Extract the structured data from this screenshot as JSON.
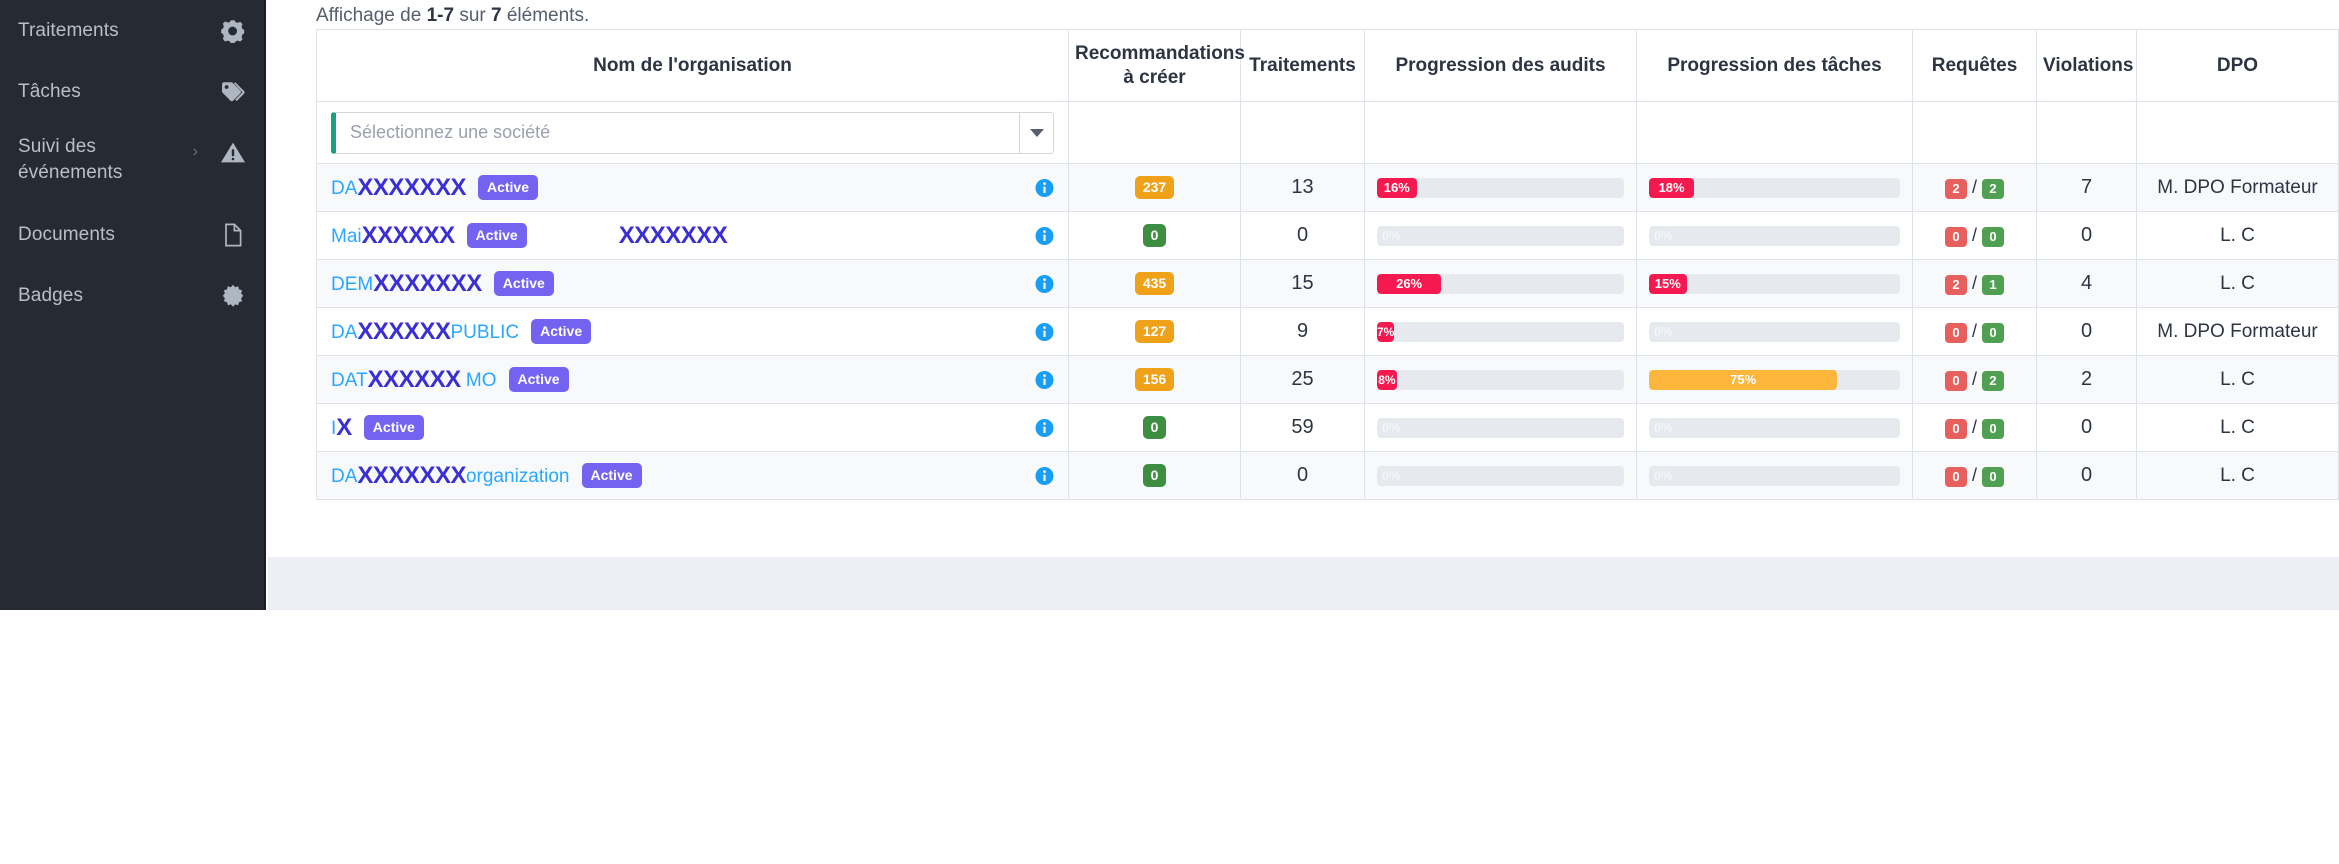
{
  "sidebar": {
    "items": [
      {
        "label": "Traitements",
        "icon": "cogs-icon",
        "has_chevron": false
      },
      {
        "label": "Tâches",
        "icon": "tags-icon",
        "has_chevron": false
      },
      {
        "label": "Suivi des événements",
        "icon": "warning-triangle-icon",
        "has_chevron": true,
        "chevron": "›"
      },
      {
        "label": "Documents",
        "icon": "file-icon",
        "has_chevron": false
      },
      {
        "label": "Badges",
        "icon": "badge-icon",
        "has_chevron": false
      }
    ],
    "background_color": "#262b33",
    "text_color": "#b9bfc8"
  },
  "summary": {
    "prefix": "Affichage de ",
    "range": "1-7",
    "middle": " sur ",
    "total": "7",
    "suffix": " éléments."
  },
  "filter": {
    "select_placeholder": "Sélectionnez une société",
    "accent_color": "#1aa083",
    "arrow_icon": "chevron-down-icon"
  },
  "table": {
    "columns": [
      "Nom de l'organisation",
      "Recommandations\nà créer",
      "Traitements",
      "Progression des audits",
      "Progression des tâches",
      "Requêtes",
      "Violations",
      "DPO"
    ],
    "columns_split": {
      "reco_line1": "Recommandations",
      "reco_line2": "à créer"
    },
    "badge_label": "Active",
    "info_icon": "info-circle-icon",
    "rows": [
      {
        "name_prefix": "DA",
        "name_redacted": "XXXXXXX",
        "name_suffix": "",
        "name_extra": "",
        "status": "Active",
        "recommandations": "237",
        "recommandations_color": "orange",
        "traitements": "13",
        "audit_pct": 16,
        "audit_label": "16%",
        "audit_color": "red",
        "task_pct": 18,
        "task_label": "18%",
        "task_color": "red",
        "requetes_red": "2",
        "requetes_green": "2",
        "violations": "7",
        "dpo": "M. DPO Formateur"
      },
      {
        "name_prefix": "Mai",
        "name_redacted": "XXXXXX",
        "name_suffix": "",
        "name_extra": "XXXXXXX",
        "status": "Active",
        "recommandations": "0",
        "recommandations_color": "green",
        "traitements": "0",
        "audit_pct": 0,
        "audit_label": "0%",
        "audit_color": "zero",
        "task_pct": 0,
        "task_label": "0%",
        "task_color": "zero",
        "requetes_red": "0",
        "requetes_green": "0",
        "violations": "0",
        "dpo": "L. C"
      },
      {
        "name_prefix": "DEM",
        "name_redacted": "XXXXXXX",
        "name_suffix": "",
        "name_extra": "",
        "status": "Active",
        "recommandations": "435",
        "recommandations_color": "orange",
        "traitements": "15",
        "audit_pct": 26,
        "audit_label": "26%",
        "audit_color": "red",
        "task_pct": 15,
        "task_label": "15%",
        "task_color": "red",
        "requetes_red": "2",
        "requetes_green": "1",
        "violations": "4",
        "dpo": "L. C"
      },
      {
        "name_prefix": "DA",
        "name_redacted": "XXXXXX",
        "name_suffix": "PUBLIC",
        "name_extra": "",
        "status": "Active",
        "recommandations": "127",
        "recommandations_color": "orange",
        "traitements": "9",
        "audit_pct": 7,
        "audit_label": "7%",
        "audit_color": "red",
        "task_pct": 0,
        "task_label": "0%",
        "task_color": "zero",
        "requetes_red": "0",
        "requetes_green": "0",
        "violations": "0",
        "dpo": "M. DPO Formateur"
      },
      {
        "name_prefix": "DAT",
        "name_redacted": "XXXXXX",
        "name_suffix": "MO",
        "name_extra": "",
        "status": "Active",
        "recommandations": "156",
        "recommandations_color": "orange",
        "traitements": "25",
        "audit_pct": 8,
        "audit_label": "8%",
        "audit_color": "red",
        "task_pct": 75,
        "task_label": "75%",
        "task_color": "amber",
        "requetes_red": "0",
        "requetes_green": "2",
        "violations": "2",
        "dpo": "L. C"
      },
      {
        "name_prefix": "I",
        "name_redacted": "X",
        "name_suffix": "",
        "name_extra": "",
        "status": "Active",
        "recommandations": "0",
        "recommandations_color": "green",
        "traitements": "59",
        "audit_pct": 0,
        "audit_label": "0%",
        "audit_color": "zero",
        "task_pct": 0,
        "task_label": "0%",
        "task_color": "zero",
        "requetes_red": "0",
        "requetes_green": "0",
        "violations": "0",
        "dpo": "L. C"
      },
      {
        "name_prefix": "DA",
        "name_redacted": "XXXXXXX",
        "name_suffix": "organization",
        "name_extra": "",
        "status": "Active",
        "recommandations": "0",
        "recommandations_color": "green",
        "traitements": "0",
        "audit_pct": 0,
        "audit_label": "0%",
        "audit_color": "zero",
        "task_pct": 0,
        "task_label": "0%",
        "task_color": "zero",
        "requetes_red": "0",
        "requetes_green": "0",
        "violations": "0",
        "dpo": "L. C"
      }
    ]
  },
  "colors": {
    "orange_badge": "#f0a11a",
    "green_badge": "#3e8e41",
    "red_bar": "#f5194f",
    "amber_bar": "#fcb63c",
    "active_badge": "#7363f0",
    "link": "#29a7ff",
    "redaction": "#3b2fd4",
    "info_icon": "#1a9ef4"
  }
}
